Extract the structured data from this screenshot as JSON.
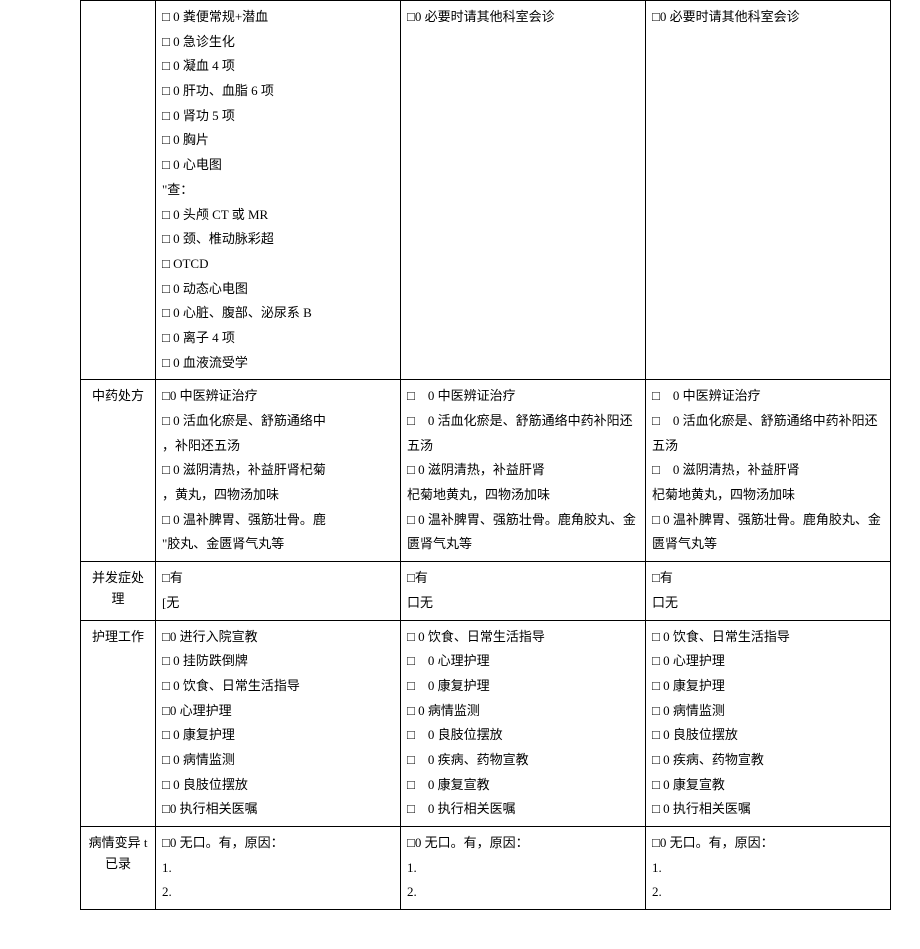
{
  "rows": [
    {
      "label": "",
      "c1": [
        "□ 0 粪便常规+潜血",
        "□ 0 急诊生化",
        "□ 0 凝血 4 项",
        "□ 0 肝功、血脂 6 项",
        "□ 0 肾功 5 项",
        "□ 0 胸片",
        "□ 0 心电图",
        "\"查：",
        "□ 0 头颅 CT 或 MR",
        "□ 0 颈、椎动脉彩超",
        "□ OTCD",
        "□ 0 动态心电图",
        "□ 0 心脏、腹部、泌尿系 B",
        " ",
        "□ 0 离子 4 项",
        "□ 0 血液流受学"
      ],
      "c2": [
        "□0 必要时请其他科室会诊"
      ],
      "c3": [
        "□0 必要时请其他科室会诊"
      ]
    },
    {
      "label": "中药处方",
      "c1": [
        "□0 中医辨证治疗",
        "□ 0 活血化瘀是、舒筋通络中",
        "，补阳还五汤",
        "□ 0 滋阴清热，补益肝肾杞菊",
        "，黄丸，四物汤加味",
        "□ 0 温补脾胃、强筋壮骨。鹿",
        "\"胶丸、金匮肾气丸等"
      ],
      "c2": [
        "□　0 中医辨证治疗",
        "□　0 活血化瘀是、舒筋通络中药补阳还五汤",
        "□ 0 滋阴清热，补益肝肾",
        "杞菊地黄丸，四物汤加味",
        "□ 0 温补脾胃、强筋壮骨。鹿角胶丸、金匮肾气丸等"
      ],
      "c3": [
        "□　0 中医辨证治疗",
        "□　0 活血化瘀是、舒筋通络中药补阳还五汤",
        "□　0 滋阴清热，补益肝肾",
        "杞菊地黄丸，四物汤加味",
        "□ 0 温补脾胃、强筋壮骨。鹿角胶丸、金匮肾气丸等"
      ]
    },
    {
      "label": "并发症处理",
      "c1": [
        "□有",
        "[无"
      ],
      "c2": [
        "□有",
        "口无"
      ],
      "c3": [
        "□有",
        "口无"
      ]
    },
    {
      "label": "护理工作",
      "c1": [
        "□0 进行入院宣教",
        "□ 0 挂防跌倒牌",
        "□ 0 饮食、日常生活指导",
        "□0 心理护理",
        "□ 0 康复护理",
        "□ 0 病情监测",
        "□ 0 良肢位摆放",
        "□0 执行相关医嘱"
      ],
      "c2": [
        "□ 0 饮食、日常生活指导",
        "□　0 心理护理",
        "□　0 康复护理",
        "□ 0 病情监测",
        "□　0 良肢位摆放",
        "□　0 疾病、药物宣教",
        "□　0 康复宣教",
        "□　0 执行相关医嘱"
      ],
      "c3": [
        "□ 0 饮食、日常生活指导",
        "□ 0 心理护理",
        "□ 0 康复护理",
        "□ 0 病情监测",
        "□ 0 良肢位摆放",
        "□ 0 疾病、药物宣教",
        "□ 0 康复宣教",
        "□ 0 执行相关医嘱"
      ]
    },
    {
      "label": "病情变异 t 已录",
      "c1": [
        "□0 无口。有，原因：",
        "1.",
        "2."
      ],
      "c2": [
        "□0 无口。有，原因：",
        "1.",
        "2."
      ],
      "c3": [
        "□0 无口。有，原因：",
        "1.",
        "2."
      ]
    }
  ]
}
